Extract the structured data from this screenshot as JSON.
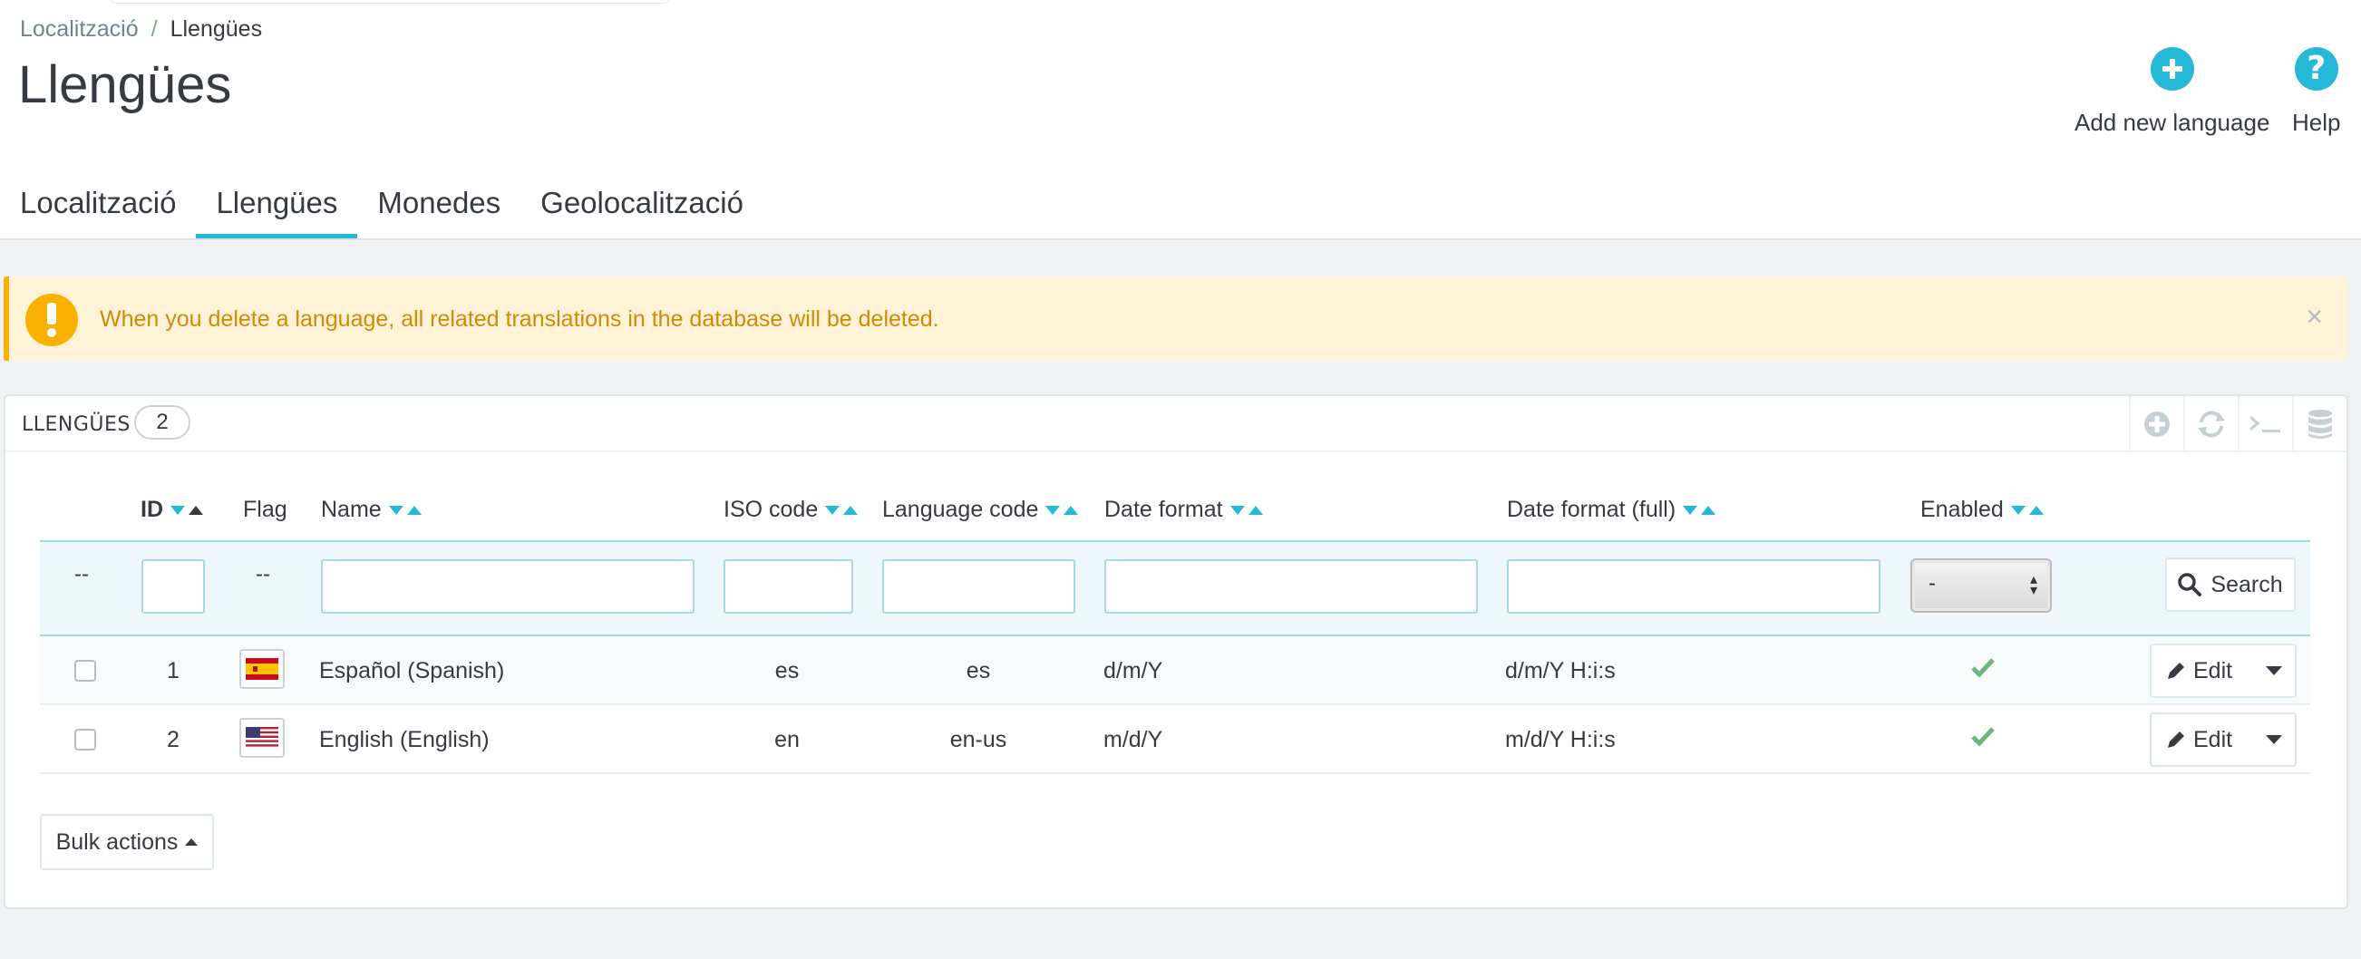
{
  "breadcrumb": {
    "parent": "Localització",
    "separator": "/",
    "current": "Llengües"
  },
  "page_title": "Llengües",
  "toolbar": {
    "add_label": "Add new language",
    "help_label": "Help"
  },
  "tabs": [
    {
      "label": "Localització",
      "active": false
    },
    {
      "label": "Llengües",
      "active": true
    },
    {
      "label": "Monedes",
      "active": false
    },
    {
      "label": "Geolocalització",
      "active": false
    }
  ],
  "alert": {
    "text": "When you delete a language, all related translations in the database will be deleted.",
    "close": "×"
  },
  "panel": {
    "title": "Llengües",
    "count": "2"
  },
  "table": {
    "headers": {
      "id": "ID",
      "flag": "Flag",
      "name": "Name",
      "iso": "ISO code",
      "lang_code": "Language code",
      "date_format": "Date format",
      "date_format_full": "Date format (full)",
      "enabled": "Enabled"
    },
    "filters": {
      "placeholder_dash": "--",
      "enabled_value": "-",
      "search_label": "Search"
    },
    "rows": [
      {
        "id": "1",
        "name": "Español (Spanish)",
        "iso": "es",
        "lang_code": "es",
        "date_format": "d/m/Y",
        "date_format_full": "d/m/Y H:i:s",
        "enabled": true,
        "flag": "spain-flag-icon"
      },
      {
        "id": "2",
        "name": "English (English)",
        "iso": "en",
        "lang_code": "en-us",
        "date_format": "m/d/Y",
        "date_format_full": "m/d/Y H:i:s",
        "enabled": true,
        "flag": "usa-flag-icon"
      }
    ],
    "edit_label": "Edit",
    "bulk_label": "Bulk actions"
  },
  "colors": {
    "accent": "#25b9d7",
    "warning": "#fab000",
    "warning_bg": "#fff3d7",
    "success": "#70b580",
    "text": "#363a41"
  }
}
